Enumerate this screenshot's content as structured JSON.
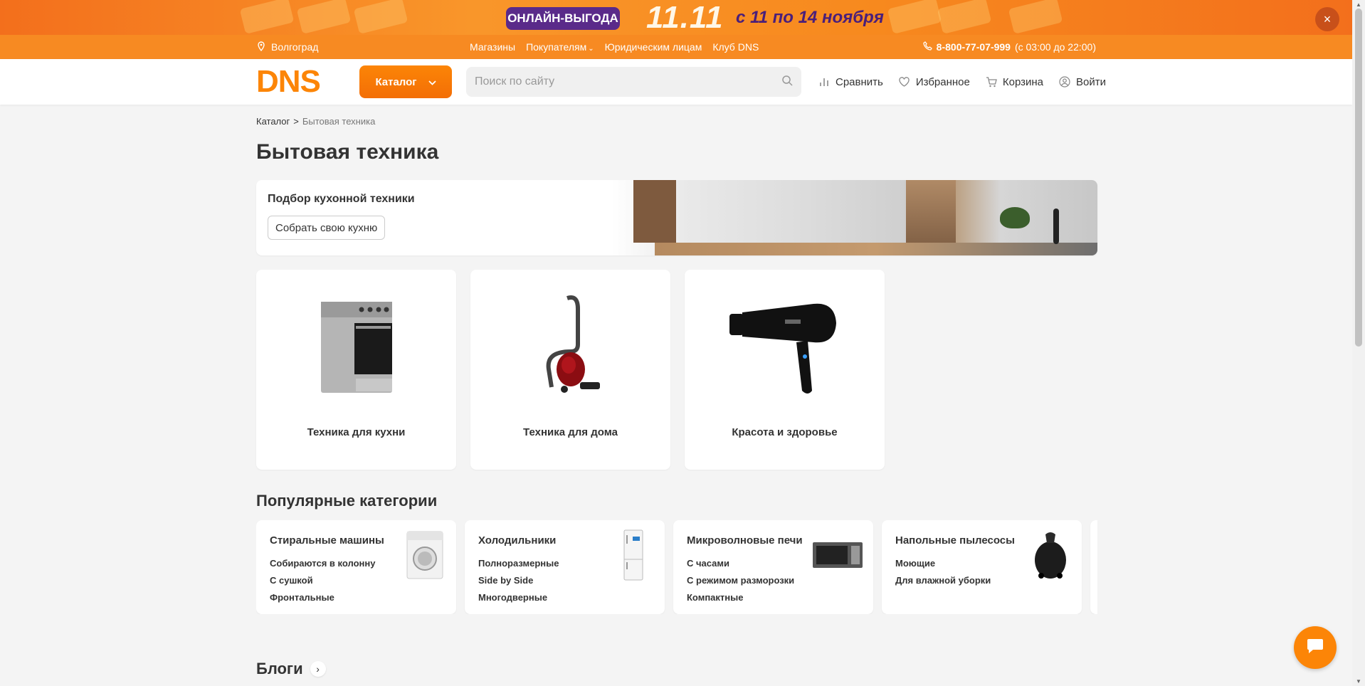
{
  "promo": {
    "tag": "ОНЛАЙН-ВЫГОДА",
    "big": "11.11",
    "dates": "с 11 по 14 ноября",
    "close_icon": "×"
  },
  "topbar": {
    "city": "Волгоград",
    "links": [
      "Магазины",
      "Покупателям",
      "Юридическим лицам",
      "Клуб DNS"
    ],
    "phone": "8-800-77-07-999",
    "hours": "(с 03:00 до 22:00)"
  },
  "header": {
    "logo": "DNS",
    "catalog_label": "Каталог",
    "search_placeholder": "Поиск по сайту",
    "nav": {
      "compare": "Сравнить",
      "favorites": "Избранное",
      "cart": "Корзина",
      "login": "Войти"
    }
  },
  "breadcrumb": {
    "root": "Каталог",
    "separator": ">",
    "current": "Бытовая техника"
  },
  "page_title": "Бытовая техника",
  "kitchen_promo": {
    "title": "Подбор кухонной техники",
    "button": "Собрать свою кухню"
  },
  "categories": [
    {
      "label": "Техника для кухни",
      "icon": "stove-icon"
    },
    {
      "label": "Техника для дома",
      "icon": "vacuum-icon"
    },
    {
      "label": "Красота и здоровье",
      "icon": "hair-dryer-icon"
    }
  ],
  "popular": {
    "title": "Популярные категории",
    "items": [
      {
        "title": "Стиральные машины",
        "subs": [
          "Собираются в колонну",
          "С сушкой",
          "Фронтальные"
        ],
        "icon": "washing-machine-icon"
      },
      {
        "title": "Холодильники",
        "subs": [
          "Полноразмерные",
          "Side by Side",
          "Многодверные"
        ],
        "icon": "fridge-icon"
      },
      {
        "title": "Микроволновые печи",
        "subs": [
          "С часами",
          "С режимом разморозки",
          "Компактные"
        ],
        "icon": "microwave-icon"
      },
      {
        "title": "Напольные пылесосы",
        "subs": [
          "Моющие",
          "Для влажной уборки"
        ],
        "icon": "floor-vacuum-icon"
      }
    ]
  },
  "blogs": {
    "title": "Блоги"
  },
  "colors": {
    "brand": "#fc8507",
    "topbar": "#f78a22",
    "promo_purple": "#5a2a8a"
  }
}
